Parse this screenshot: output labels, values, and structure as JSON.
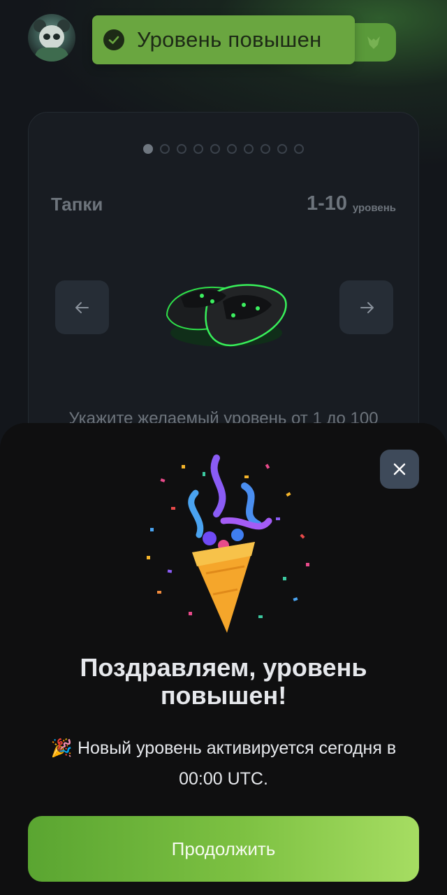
{
  "header": {
    "toast_text": "Уровень повышен"
  },
  "card": {
    "pager_total": 10,
    "pager_active_index": 0,
    "item_name": "Тапки",
    "level_range": "1-10",
    "level_word": "уровень",
    "hint": "Укажите желаемый уровень от 1 до 100"
  },
  "sheet": {
    "title": "Поздравляем, уровень повышен!",
    "emoji": "🎉",
    "description": "Новый уровень активируется сегодня в 00:00 UTC.",
    "continue_label": "Продолжить"
  },
  "icons": {
    "toast": "check-circle-icon",
    "prev": "arrow-left-icon",
    "next": "arrow-right-icon",
    "close": "close-icon",
    "pill": "fox-logo-icon"
  },
  "colors": {
    "accent_green": "#6aa640",
    "button_gradient_start": "#5aa531",
    "button_gradient_end": "#a6dd62",
    "sheet_bg": "#0f0f10",
    "page_bg": "#13161b"
  }
}
